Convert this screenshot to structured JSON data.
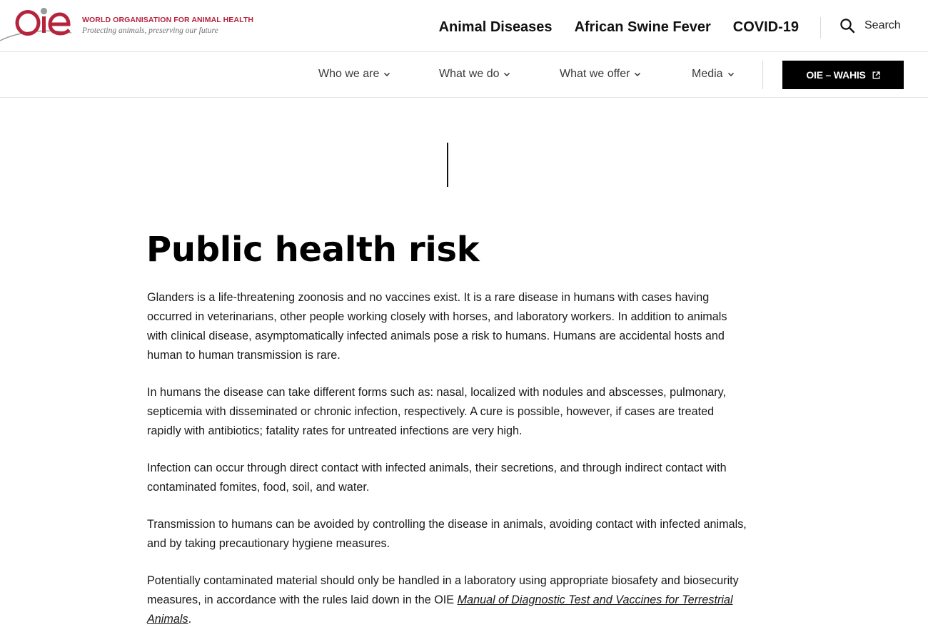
{
  "brand": {
    "org_name": "WORLD ORGANISATION FOR ANIMAL HEALTH",
    "tagline": "Protecting animals, preserving our future",
    "logo_text": "OIE",
    "logo_color": "#b5243c"
  },
  "top_nav": {
    "links": [
      "Animal Diseases",
      "African Swine Fever",
      "COVID-19"
    ],
    "search_label": "Search",
    "search_icon": "search-icon"
  },
  "sub_nav": {
    "items": [
      {
        "label": "Who we are",
        "icon": "chevron-down-icon"
      },
      {
        "label": "What we do",
        "icon": "chevron-down-icon"
      },
      {
        "label": "What we offer",
        "icon": "chevron-down-icon"
      },
      {
        "label": "Media",
        "icon": "chevron-down-icon"
      }
    ],
    "cta": {
      "label": "OIE – WAHIS",
      "icon": "external-link-icon",
      "background": "#000000"
    }
  },
  "article": {
    "title": "Public health risk",
    "paragraphs": [
      "Glanders is a life-threatening zoonosis and no vaccines exist. It is a rare disease in humans with cases having occurred in veterinarians, other people working closely with horses, and laboratory workers. In addition to animals with clinical disease, asymptomatically infected animals pose a risk to humans. Humans are accidental hosts and human to human transmission is rare.",
      "In humans the disease can take different forms such as: nasal, localized with nodules and abscesses, pulmonary, septicemia with disseminated or chronic infection, respectively. A cure is possible, however, if cases are treated rapidly with antibiotics; fatality rates for untreated infections are very high.",
      "Infection can occur through direct contact with infected animals, their secretions, and through indirect contact with contaminated fomites, food, soil, and water.",
      "Transmission to humans can be avoided by controlling the disease in animals, avoiding contact with infected animals, and by taking precautionary hygiene measures."
    ],
    "last_paragraph": {
      "before": "Potentially contaminated material should only be handled in a laboratory using appropriate biosafety and biosecurity measures, in accordance with the rules laid down in the OIE ",
      "link": "Manual of Diagnostic Test and Vaccines for Terrestrial Animals",
      "after": "."
    }
  }
}
